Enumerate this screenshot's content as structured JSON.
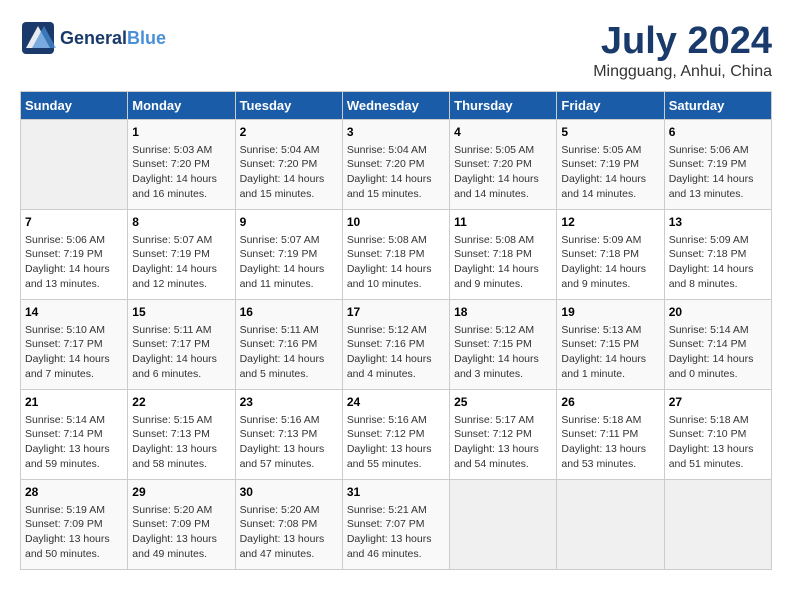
{
  "logo": {
    "line1": "General",
    "line2": "Blue",
    "tagline": ""
  },
  "title": "July 2024",
  "subtitle": "Mingguang, Anhui, China",
  "days_of_week": [
    "Sunday",
    "Monday",
    "Tuesday",
    "Wednesday",
    "Thursday",
    "Friday",
    "Saturday"
  ],
  "weeks": [
    [
      {
        "day": "",
        "info": ""
      },
      {
        "day": "1",
        "info": "Sunrise: 5:03 AM\nSunset: 7:20 PM\nDaylight: 14 hours\nand 16 minutes."
      },
      {
        "day": "2",
        "info": "Sunrise: 5:04 AM\nSunset: 7:20 PM\nDaylight: 14 hours\nand 15 minutes."
      },
      {
        "day": "3",
        "info": "Sunrise: 5:04 AM\nSunset: 7:20 PM\nDaylight: 14 hours\nand 15 minutes."
      },
      {
        "day": "4",
        "info": "Sunrise: 5:05 AM\nSunset: 7:20 PM\nDaylight: 14 hours\nand 14 minutes."
      },
      {
        "day": "5",
        "info": "Sunrise: 5:05 AM\nSunset: 7:19 PM\nDaylight: 14 hours\nand 14 minutes."
      },
      {
        "day": "6",
        "info": "Sunrise: 5:06 AM\nSunset: 7:19 PM\nDaylight: 14 hours\nand 13 minutes."
      }
    ],
    [
      {
        "day": "7",
        "info": "Sunrise: 5:06 AM\nSunset: 7:19 PM\nDaylight: 14 hours\nand 13 minutes."
      },
      {
        "day": "8",
        "info": "Sunrise: 5:07 AM\nSunset: 7:19 PM\nDaylight: 14 hours\nand 12 minutes."
      },
      {
        "day": "9",
        "info": "Sunrise: 5:07 AM\nSunset: 7:19 PM\nDaylight: 14 hours\nand 11 minutes."
      },
      {
        "day": "10",
        "info": "Sunrise: 5:08 AM\nSunset: 7:18 PM\nDaylight: 14 hours\nand 10 minutes."
      },
      {
        "day": "11",
        "info": "Sunrise: 5:08 AM\nSunset: 7:18 PM\nDaylight: 14 hours\nand 9 minutes."
      },
      {
        "day": "12",
        "info": "Sunrise: 5:09 AM\nSunset: 7:18 PM\nDaylight: 14 hours\nand 9 minutes."
      },
      {
        "day": "13",
        "info": "Sunrise: 5:09 AM\nSunset: 7:18 PM\nDaylight: 14 hours\nand 8 minutes."
      }
    ],
    [
      {
        "day": "14",
        "info": "Sunrise: 5:10 AM\nSunset: 7:17 PM\nDaylight: 14 hours\nand 7 minutes."
      },
      {
        "day": "15",
        "info": "Sunrise: 5:11 AM\nSunset: 7:17 PM\nDaylight: 14 hours\nand 6 minutes."
      },
      {
        "day": "16",
        "info": "Sunrise: 5:11 AM\nSunset: 7:16 PM\nDaylight: 14 hours\nand 5 minutes."
      },
      {
        "day": "17",
        "info": "Sunrise: 5:12 AM\nSunset: 7:16 PM\nDaylight: 14 hours\nand 4 minutes."
      },
      {
        "day": "18",
        "info": "Sunrise: 5:12 AM\nSunset: 7:15 PM\nDaylight: 14 hours\nand 3 minutes."
      },
      {
        "day": "19",
        "info": "Sunrise: 5:13 AM\nSunset: 7:15 PM\nDaylight: 14 hours\nand 1 minute."
      },
      {
        "day": "20",
        "info": "Sunrise: 5:14 AM\nSunset: 7:14 PM\nDaylight: 14 hours\nand 0 minutes."
      }
    ],
    [
      {
        "day": "21",
        "info": "Sunrise: 5:14 AM\nSunset: 7:14 PM\nDaylight: 13 hours\nand 59 minutes."
      },
      {
        "day": "22",
        "info": "Sunrise: 5:15 AM\nSunset: 7:13 PM\nDaylight: 13 hours\nand 58 minutes."
      },
      {
        "day": "23",
        "info": "Sunrise: 5:16 AM\nSunset: 7:13 PM\nDaylight: 13 hours\nand 57 minutes."
      },
      {
        "day": "24",
        "info": "Sunrise: 5:16 AM\nSunset: 7:12 PM\nDaylight: 13 hours\nand 55 minutes."
      },
      {
        "day": "25",
        "info": "Sunrise: 5:17 AM\nSunset: 7:12 PM\nDaylight: 13 hours\nand 54 minutes."
      },
      {
        "day": "26",
        "info": "Sunrise: 5:18 AM\nSunset: 7:11 PM\nDaylight: 13 hours\nand 53 minutes."
      },
      {
        "day": "27",
        "info": "Sunrise: 5:18 AM\nSunset: 7:10 PM\nDaylight: 13 hours\nand 51 minutes."
      }
    ],
    [
      {
        "day": "28",
        "info": "Sunrise: 5:19 AM\nSunset: 7:09 PM\nDaylight: 13 hours\nand 50 minutes."
      },
      {
        "day": "29",
        "info": "Sunrise: 5:20 AM\nSunset: 7:09 PM\nDaylight: 13 hours\nand 49 minutes."
      },
      {
        "day": "30",
        "info": "Sunrise: 5:20 AM\nSunset: 7:08 PM\nDaylight: 13 hours\nand 47 minutes."
      },
      {
        "day": "31",
        "info": "Sunrise: 5:21 AM\nSunset: 7:07 PM\nDaylight: 13 hours\nand 46 minutes."
      },
      {
        "day": "",
        "info": ""
      },
      {
        "day": "",
        "info": ""
      },
      {
        "day": "",
        "info": ""
      }
    ]
  ]
}
